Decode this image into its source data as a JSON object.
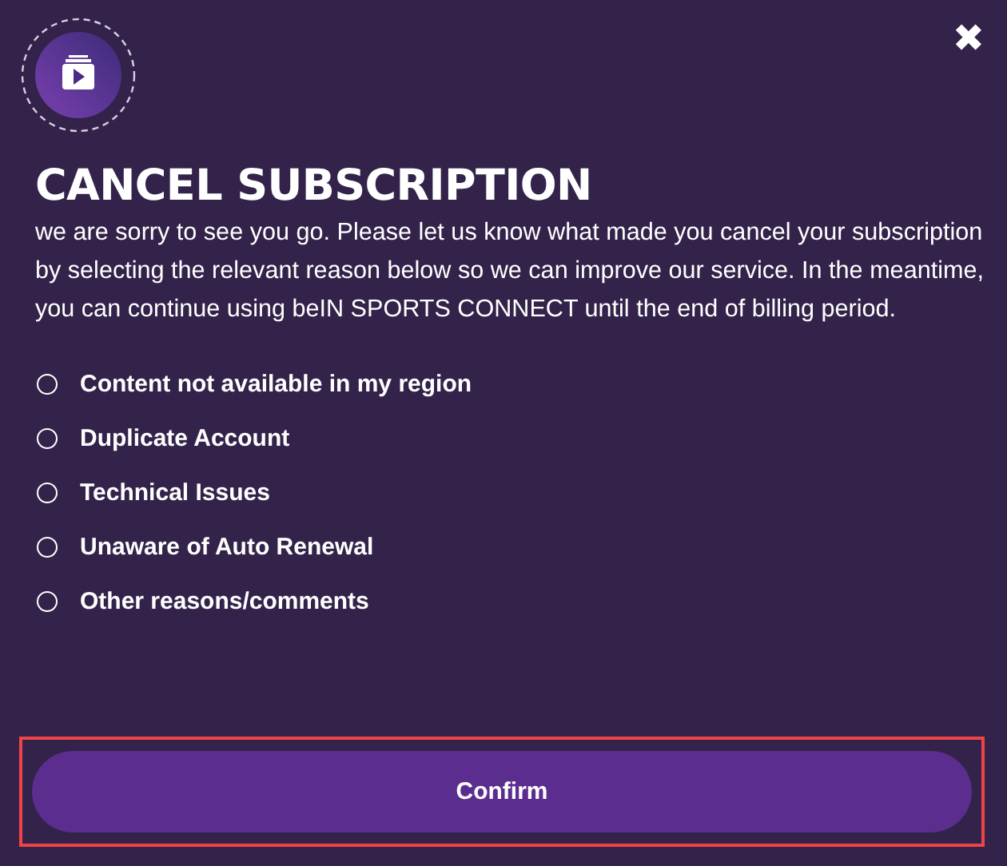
{
  "dialog": {
    "title": "CANCEL SUBSCRIPTION",
    "close": "✖",
    "message": "we are sorry to see you go. Please let us know what made you cancel your subscription by selecting the relevant reason below so we can improve our service. In the meantime, you can continue using beIN SPORTS CONNECT until the end of billing period.",
    "reasons": [
      {
        "label": "Content not available in my region",
        "selected": false
      },
      {
        "label": "Duplicate Account",
        "selected": false
      },
      {
        "label": "Technical Issues",
        "selected": false
      },
      {
        "label": "Unaware of Auto Renewal",
        "selected": false
      },
      {
        "label": "Other reasons/comments",
        "selected": false
      }
    ],
    "confirm": "Confirm",
    "confirm_highlighted": true
  }
}
